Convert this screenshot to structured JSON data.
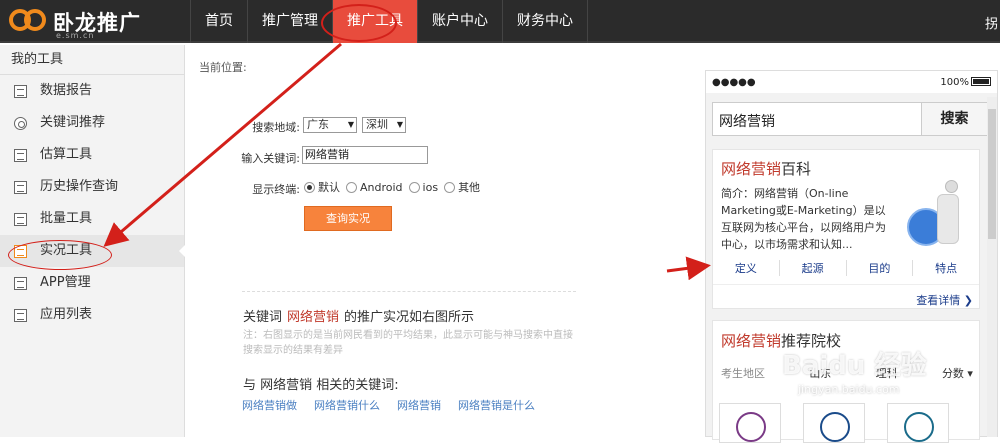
{
  "logo": {
    "name": "卧龙推广",
    "sub": "e.sm.cn"
  },
  "nav": {
    "items": [
      {
        "label": "首页",
        "active": false
      },
      {
        "label": "推广管理",
        "active": false
      },
      {
        "label": "推广工具",
        "active": true
      },
      {
        "label": "账户中心",
        "active": false
      },
      {
        "label": "财务中心",
        "active": false
      }
    ],
    "right_label": "拐"
  },
  "sidebar": {
    "title": "我的工具",
    "items": [
      {
        "label": "数据报告",
        "icon": "chart-icon",
        "active": false
      },
      {
        "label": "关键词推荐",
        "icon": "target-icon",
        "active": false
      },
      {
        "label": "估算工具",
        "icon": "calculator-icon",
        "active": false
      },
      {
        "label": "历史操作查询",
        "icon": "history-icon",
        "active": false
      },
      {
        "label": "批量工具",
        "icon": "batch-icon",
        "active": false
      },
      {
        "label": "实况工具",
        "icon": "live-icon",
        "active": true
      },
      {
        "label": "APP管理",
        "icon": "app-icon",
        "active": false
      },
      {
        "label": "应用列表",
        "icon": "list-icon",
        "active": false
      }
    ]
  },
  "breadcrumb": "当前位置:",
  "form": {
    "region_label": "搜索地域:",
    "province": "广东",
    "city": "深圳",
    "keyword_label": "输入关键词:",
    "keyword_value": "网络营销",
    "device_label": "显示终端:",
    "devices": [
      {
        "label": "默认",
        "checked": true
      },
      {
        "label": "Android",
        "checked": false
      },
      {
        "label": "ios",
        "checked": false
      },
      {
        "label": "其他",
        "checked": false
      }
    ],
    "query_button": "查询实况"
  },
  "result": {
    "prefix": "关键词",
    "keyword": "网络营销",
    "suffix": "的推广实况如右图所示",
    "note": "注：右图显示的是当前网民看到的平均结果，此显示可能与神马搜索中直接搜索显示的结果有差异",
    "related_title": "与 网络营销 相关的关键词:",
    "related": [
      "网络营销做",
      "网络营销什么",
      "网络营销",
      "网络营销是什么"
    ]
  },
  "phone": {
    "signal": "●●●●●",
    "battery": "100%",
    "search_query": "网络营销",
    "search_button": "搜索",
    "card1": {
      "title_hl": "网络营销",
      "title_rest": "百科",
      "desc": "简介：网络营销（On-line Marketing或E-Marketing）是以互联网为核心平台，以网络用户为中心，以市场需求和认知...",
      "tabs": [
        "定义",
        "起源",
        "目的",
        "特点"
      ],
      "more": "查看详情 ❯"
    },
    "card2": {
      "title_hl": "网络营销",
      "title_rest": "推荐院校",
      "filter_label": "考生地区",
      "filter_region": "山东",
      "filter_subject": "理科",
      "filter_score": "分数 ▾"
    }
  },
  "watermark": {
    "main": "Baidu 经验",
    "sub": "jingyan.baidu.com"
  },
  "colors": {
    "accent": "#e84c3d",
    "orange": "#f08a1c",
    "button": "#f7833c",
    "link": "#4a7fc1",
    "annotation": "#d3201a"
  }
}
